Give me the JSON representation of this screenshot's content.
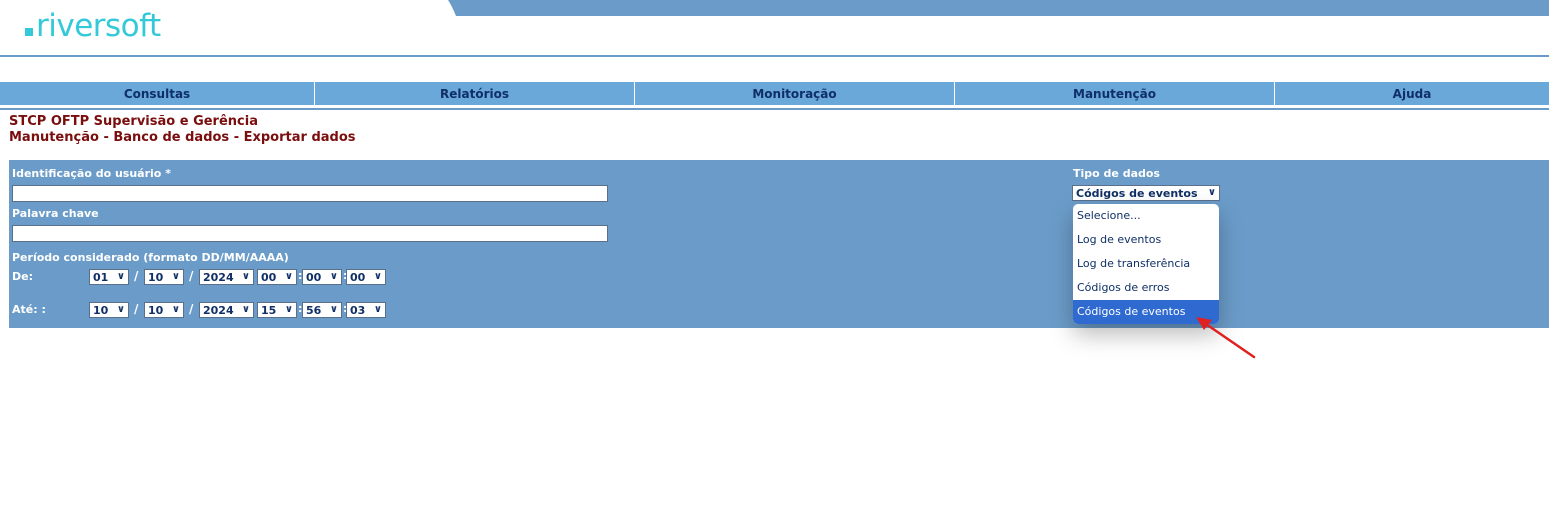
{
  "logo": {
    "text": "riversoft"
  },
  "nav": {
    "items": [
      "Consultas",
      "Relatórios",
      "Monitoração",
      "Manutenção",
      "Ajuda"
    ]
  },
  "page": {
    "title": "STCP OFTP Supervisão e Gerência",
    "subtitle": "Manutenção - Banco de dados - Exportar dados"
  },
  "form": {
    "user_id_label": "Identificação do usuário *",
    "user_id_value": "",
    "keyword_label": "Palavra chave",
    "keyword_value": "",
    "period_label": "Período considerado (formato DD/MM/AAAA)",
    "from_label": "De:",
    "to_label": "Até: :",
    "from": {
      "day": "01",
      "month": "10",
      "year": "2024",
      "hour": "00",
      "minute": "00",
      "second": "00"
    },
    "to": {
      "day": "10",
      "month": "10",
      "year": "2024",
      "hour": "15",
      "minute": "56",
      "second": "03"
    },
    "date_sep": "/",
    "time_sep": ":",
    "data_type_label": "Tipo de dados",
    "data_type_value": "Códigos de eventos",
    "data_type_options": [
      "Selecione...",
      "Log de eventos",
      "Log de transferência",
      "Códigos de erros",
      "Códigos de eventos"
    ],
    "selected_option_index": 4
  },
  "colors": {
    "brand": "#34c9d8",
    "panel": "#6b9cc9",
    "nav": "#6aa8da",
    "title": "#7a0d0d",
    "selected": "#2f6ad0",
    "annotation": "#e02020"
  },
  "icons": {
    "select_chevron": "chevron-down-icon",
    "annotation": "red-arrow-icon"
  }
}
